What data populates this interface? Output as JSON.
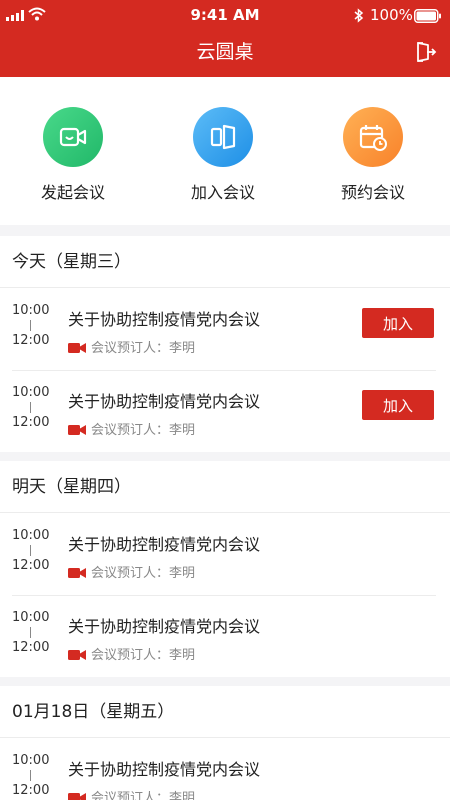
{
  "status_bar": {
    "time": "9:41 AM",
    "battery": "100%"
  },
  "nav": {
    "title": "云圆桌"
  },
  "quick_actions": [
    {
      "label": "发起会议",
      "icon": "video-call-icon",
      "color": "#2bc676"
    },
    {
      "label": "加入会议",
      "icon": "join-door-icon",
      "color": "#2f9df0"
    },
    {
      "label": "预约会议",
      "icon": "calendar-clock-icon",
      "color": "#fb9133"
    }
  ],
  "colors": {
    "brand": "#d42a21",
    "background": "#f4f4f6"
  },
  "days": [
    {
      "heading": "今天（星期三）",
      "meetings": [
        {
          "start": "10:00",
          "end": "12:00",
          "title": "关于协助控制疫情党内会议",
          "booker": "会议预订人：李明",
          "join_label": "加入"
        },
        {
          "start": "10:00",
          "end": "12:00",
          "title": "关于协助控制疫情党内会议",
          "booker": "会议预订人：李明",
          "join_label": "加入"
        }
      ]
    },
    {
      "heading": "明天（星期四）",
      "meetings": [
        {
          "start": "10:00",
          "end": "12:00",
          "title": "关于协助控制疫情党内会议",
          "booker": "会议预订人：李明"
        },
        {
          "start": "10:00",
          "end": "12:00",
          "title": "关于协助控制疫情党内会议",
          "booker": "会议预订人：李明"
        }
      ]
    },
    {
      "heading": "01月18日（星期五）",
      "meetings": [
        {
          "start": "10:00",
          "end": "12:00",
          "title": "关于协助控制疫情党内会议",
          "booker": "会议预订人：李明"
        }
      ]
    }
  ]
}
